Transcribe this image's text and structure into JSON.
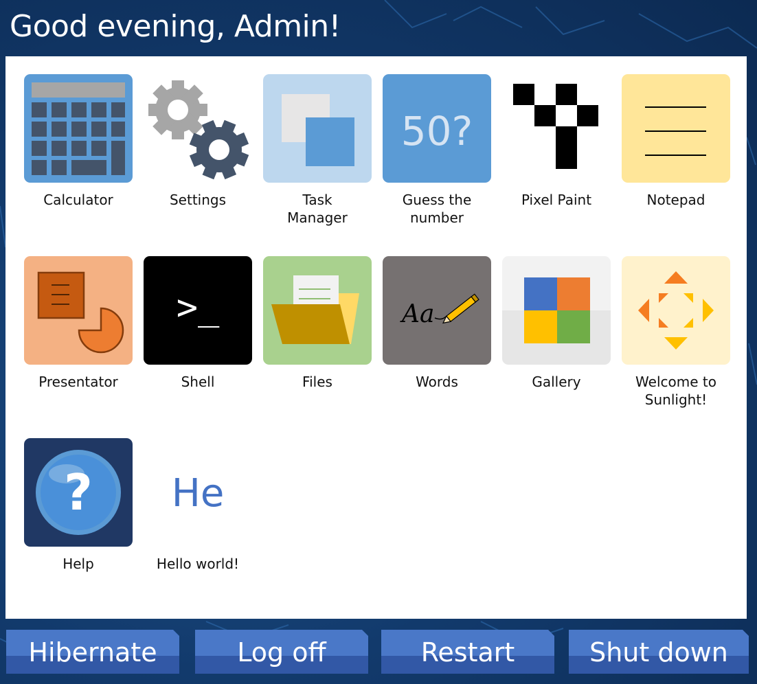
{
  "header": {
    "greeting": "Good evening, Admin!"
  },
  "apps": [
    {
      "label": "Calculator",
      "icon": "calculator-icon"
    },
    {
      "label": "Settings",
      "icon": "settings-gears-icon"
    },
    {
      "label": "Task\nManager",
      "icon": "task-manager-windows-icon"
    },
    {
      "label": "Guess the\nnumber",
      "icon": "guess-number-icon",
      "icon_text": "50?"
    },
    {
      "label": "Pixel Paint",
      "icon": "pixel-paint-icon"
    },
    {
      "label": "Notepad",
      "icon": "notepad-icon"
    },
    {
      "label": "Presentator",
      "icon": "presentator-icon"
    },
    {
      "label": "Shell",
      "icon": "shell-prompt-icon",
      "icon_text": ">_"
    },
    {
      "label": "Files",
      "icon": "folder-icon"
    },
    {
      "label": "Words",
      "icon": "words-pencil-icon",
      "icon_text": "Aa"
    },
    {
      "label": "Gallery",
      "icon": "gallery-tiles-icon"
    },
    {
      "label": "Welcome to\nSunlight!",
      "icon": "welcome-arrows-icon"
    },
    {
      "label": "Help",
      "icon": "help-question-icon",
      "icon_text": "?"
    },
    {
      "label": "Hello world!",
      "icon": "hello-text-icon",
      "icon_text": "He"
    }
  ],
  "power": {
    "hibernate": "Hibernate",
    "log_off": "Log off",
    "restart": "Restart",
    "shut_down": "Shut down"
  },
  "colors": {
    "background": "#123a6c",
    "button_top": "#4a78c8",
    "button_bottom": "#3258a6"
  }
}
